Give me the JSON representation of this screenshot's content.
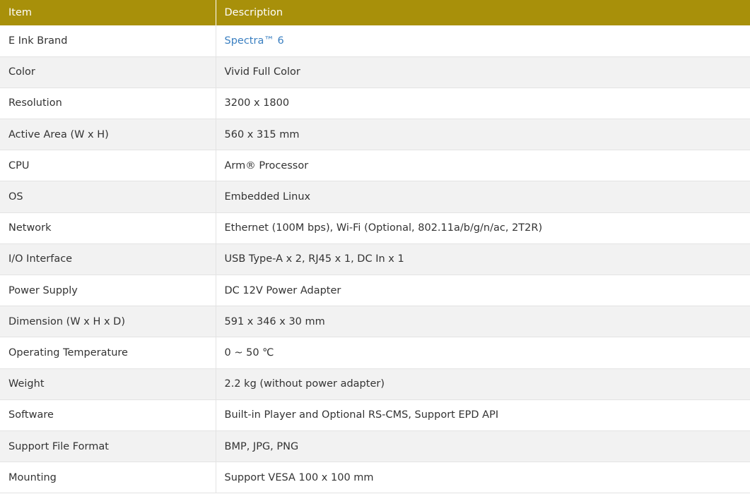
{
  "table": {
    "headers": {
      "item": "Item",
      "description": "Description"
    },
    "rows": [
      {
        "item": "E Ink Brand",
        "description": "Spectra™ 6",
        "is_link": true
      },
      {
        "item": "Color",
        "description": "Vivid Full Color"
      },
      {
        "item": "Resolution",
        "description": "3200 x 1800"
      },
      {
        "item": "Active Area (W x H)",
        "description": "560 x 315 mm"
      },
      {
        "item": "CPU",
        "description": "Arm® Processor"
      },
      {
        "item": "OS",
        "description": "Embedded Linux"
      },
      {
        "item": "Network",
        "description": "Ethernet (100M bps), Wi-Fi (Optional, 802.11a/b/g/n/ac, 2T2R)"
      },
      {
        "item": "I/O Interface",
        "description": "USB Type-A x 2, RJ45 x 1, DC In x 1"
      },
      {
        "item": "Power Supply",
        "description": "DC 12V Power Adapter"
      },
      {
        "item": "Dimension (W x H x D)",
        "description": "591 x 346 x 30 mm"
      },
      {
        "item": "Operating Temperature",
        "description": "0 ~ 50 ℃"
      },
      {
        "item": "Weight",
        "description": "2.2 kg (without power adapter)"
      },
      {
        "item": "Software",
        "description": "Built-in Player and Optional RS-CMS, Support EPD API"
      },
      {
        "item": "Support File Format",
        "description": "BMP, JPG, PNG"
      },
      {
        "item": "Mounting",
        "description": "Support VESA 100 x 100 mm"
      }
    ]
  },
  "colors": {
    "header_bg": "#a8900a",
    "header_text": "#ffffff",
    "row_alt_bg": "#f2f2f2",
    "link": "#3a7fc1"
  }
}
